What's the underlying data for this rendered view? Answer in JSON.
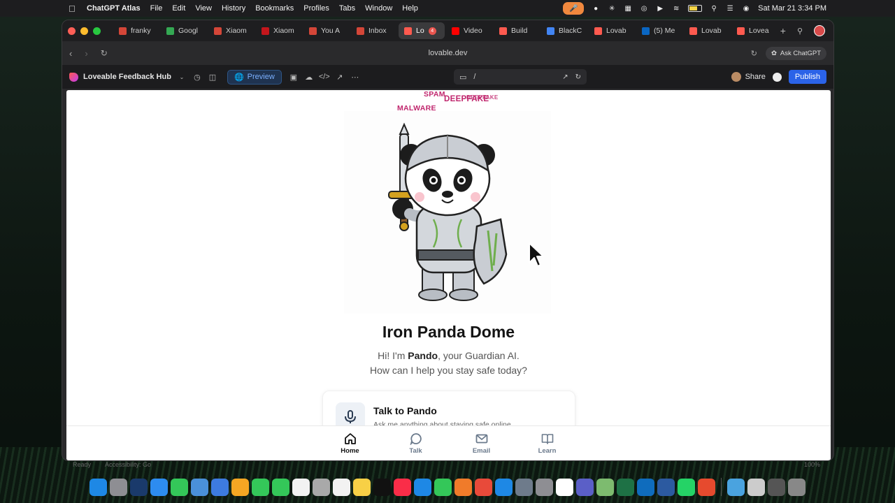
{
  "menubar": {
    "app_name": "ChatGPT Atlas",
    "menus": [
      "File",
      "Edit",
      "View",
      "History",
      "Bookmarks",
      "Profiles",
      "Tabs",
      "Window",
      "Help"
    ],
    "datetime": "Sat Mar 21  3:34 PM"
  },
  "tabs": [
    {
      "label": "franky",
      "color": "#d44638"
    },
    {
      "label": "Googl",
      "color": "#34a853"
    },
    {
      "label": "Xiaom",
      "color": "#d44638"
    },
    {
      "label": "Xiaom",
      "color": "#c4161c"
    },
    {
      "label": "You A",
      "color": "#d44638"
    },
    {
      "label": "Inbox",
      "color": "#d44638"
    },
    {
      "label": "Lo",
      "color": "#ff5a4f",
      "active": true,
      "badge": "4"
    },
    {
      "label": "Video",
      "color": "#ff0000"
    },
    {
      "label": "Build",
      "color": "#ff5a4f"
    },
    {
      "label": "BlackC",
      "color": "#4285f4"
    },
    {
      "label": "Lovab",
      "color": "#ff5a4f"
    },
    {
      "label": "(5) Me",
      "color": "#0a66c2"
    },
    {
      "label": "Lovab",
      "color": "#ff5a4f"
    },
    {
      "label": "Lovea",
      "color": "#ff5a4f"
    }
  ],
  "address": {
    "url": "lovable.dev",
    "ask_label": "Ask ChatGPT"
  },
  "lovable": {
    "project_name": "Loveable Feedback Hub",
    "preview_label": "Preview",
    "path": "/",
    "share_label": "Share",
    "publish_label": "Publish"
  },
  "page": {
    "floating_words": [
      "SPAM",
      "DEEPFAKE",
      "DEEPFAKE",
      "MALWARE"
    ],
    "title": "Iron Panda Dome",
    "subtitle_pre": "Hi! I'm ",
    "subtitle_name": "Pando",
    "subtitle_post": ", your Guardian AI.",
    "subtitle_line2": "How can I help you stay safe today?",
    "talk_card": {
      "title": "Talk to Pando",
      "desc": "Ask me anything about staying safe online"
    },
    "bottom_nav": [
      {
        "label": "Home",
        "icon": "home-icon",
        "active": true
      },
      {
        "label": "Talk",
        "icon": "chat-bubble-icon"
      },
      {
        "label": "Email",
        "icon": "envelope-icon"
      },
      {
        "label": "Learn",
        "icon": "book-icon"
      }
    ]
  },
  "status": {
    "ready": "Ready",
    "accessibility": "Accessibility: Go",
    "zoom": "100%"
  },
  "dock_colors": [
    "#1e88e5",
    "#8e8e93",
    "#1a3a6b",
    "#2d8cf0",
    "#34c759",
    "#4a90d9",
    "#3d7be0",
    "#f5a623",
    "#34c759",
    "#34c759",
    "#f2f2f2",
    "#a9a9a9",
    "#f2f2f2",
    "#f7d046",
    "#111111",
    "#fa2d48",
    "#1e88e5",
    "#34c759",
    "#f07b2a",
    "#e84a3a",
    "#1e88e5",
    "#6e7b8b",
    "#8e8e93",
    "#ffffff",
    "#5b5fc7",
    "#7dbb6f",
    "#1e7145",
    "#0f6cbd",
    "#2c5aa0",
    "#25d366",
    "#e64a2e",
    "#4aa3df",
    "#cccccc",
    "#555555",
    "#888888"
  ]
}
